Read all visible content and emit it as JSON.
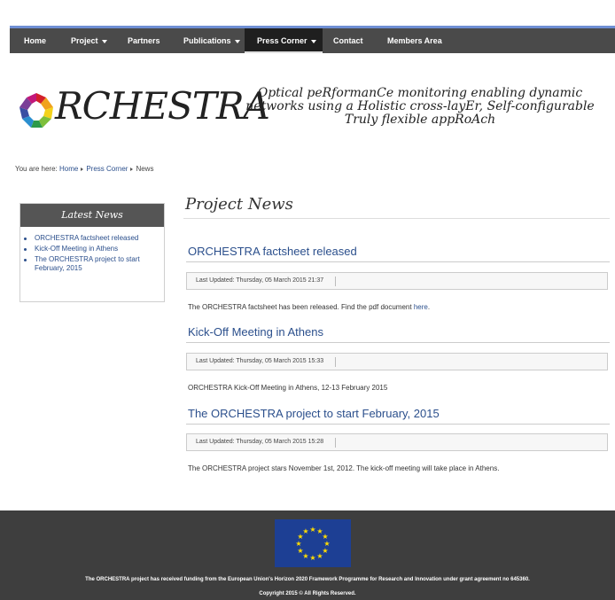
{
  "nav": {
    "items": [
      {
        "label": "Home",
        "has_caret": false
      },
      {
        "label": "Project",
        "has_caret": true
      },
      {
        "label": "Partners",
        "has_caret": false
      },
      {
        "label": "Publications",
        "has_caret": true
      },
      {
        "label": "Press Corner",
        "has_caret": true,
        "active": true
      },
      {
        "label": "Contact",
        "has_caret": false
      },
      {
        "label": "Members Area",
        "has_caret": false
      }
    ],
    "accent_color": "#6f8fd4",
    "background_color": "#4a4a4a"
  },
  "header": {
    "logo_text": "RCHESTRA",
    "tagline": "Optical peRformanCe monitoring enabling dynamic networks using a Holistic cross-layEr, Self-configurable Truly flexible appRoAch"
  },
  "breadcrumb": {
    "prefix": "You are here:",
    "items": [
      "Home",
      "Press Corner",
      "News"
    ]
  },
  "sidebar": {
    "title": "Latest News",
    "items": [
      "ORCHESTRA factsheet released",
      "Kick-Off Meeting in Athens",
      "The ORCHESTRA project to start February, 2015"
    ]
  },
  "main": {
    "title": "Project News",
    "articles": [
      {
        "title": "ORCHESTRA factsheet released",
        "meta": "Last Updated: Thursday, 05 March 2015 21:37",
        "body": "The ORCHESTRA factsheet has been released. Find the pdf document",
        "link": "here",
        "tail": "."
      },
      {
        "title": "Kick-Off Meeting in Athens",
        "meta": "Last Updated: Thursday, 05 March 2015 15:33",
        "body": "ORCHESTRA Kick-Off Meeting in Athens, 12-13 February 2015"
      },
      {
        "title": "The ORCHESTRA project to start February, 2015",
        "meta": "Last Updated: Thursday, 05 March 2015 15:28",
        "body": "The ORCHESTRA project stars November 1st, 2012. The kick-off meeting will take place in Athens."
      }
    ]
  },
  "footer": {
    "funding": "The ORCHESTRA project has received funding from the European Union's Horizon 2020 Framework Programme for Research and Innovation under grant agreement no 645360.",
    "copyright": "Copyright 2015 © All Rights Reserved.",
    "flag_icon": "eu-flag-icon"
  }
}
